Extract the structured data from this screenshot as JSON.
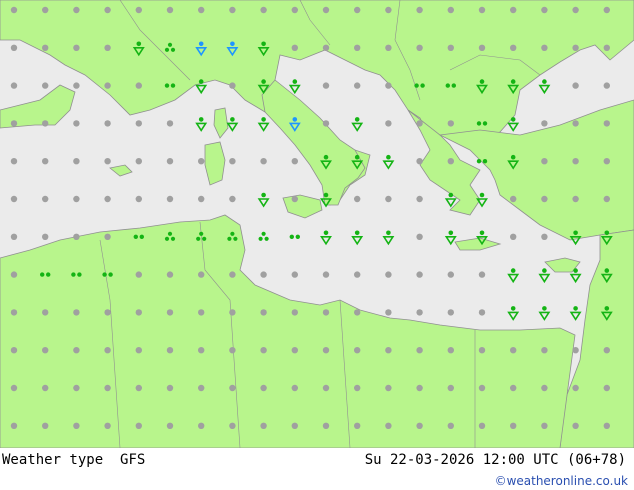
{
  "footer": {
    "product": "Weather type",
    "model": "GFS",
    "valid_time": "Su 22-03-2026 12:00 UTC (06+78)",
    "credit": "©weatheronline.co.uk"
  },
  "colors": {
    "sea": "#ebebeb",
    "land": "#b8f58c",
    "coast": "#909090",
    "dot": "#a0a0a0",
    "rain_symbol": "#14b414",
    "snow_symbol": "#1e96ff"
  },
  "legend_icons": {
    "dry": "grey-dot-icon",
    "partly_dry": "half-dot-icon",
    "drizzle": "two-dots-icon",
    "showers": "three-dots-icon",
    "rain_showers": "rain-shower-icon",
    "snow_showers": "snow-shower-icon"
  }
}
